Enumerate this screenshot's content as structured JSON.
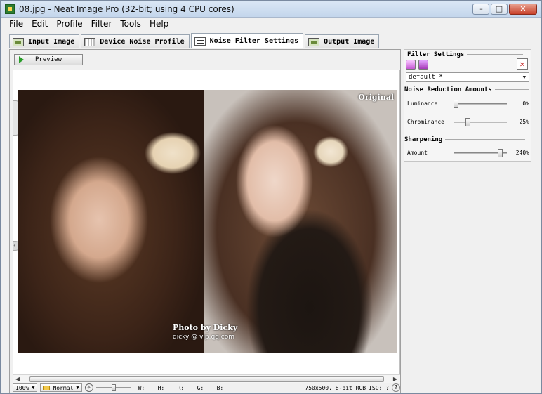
{
  "window": {
    "title": "08.jpg - Neat Image Pro (32-bit; using 4 CPU cores)",
    "minimize": "–",
    "maximize": "□",
    "close": "✕"
  },
  "menu": [
    "File",
    "Edit",
    "Profile",
    "Filter",
    "Tools",
    "Help"
  ],
  "tabs": [
    {
      "label": "Input Image",
      "icon": "input-image-icon"
    },
    {
      "label": "Device Noise Profile",
      "icon": "noise-profile-icon"
    },
    {
      "label": "Noise Filter Settings",
      "icon": "filter-settings-icon",
      "active": true
    },
    {
      "label": "Output Image",
      "icon": "output-image-icon"
    }
  ],
  "preview": {
    "button_label": "Preview",
    "overlay_label": "Original",
    "credit_line1": "Photo by Dicky",
    "credit_line2": "dicky @ vip.qq.com"
  },
  "statusbar": {
    "zoom": "100%",
    "mode": "Normal",
    "w_label": "W:",
    "h_label": "H:",
    "r_label": "R:",
    "g_label": "G:",
    "b_label": "B:",
    "image_info": "750x500, 8-bit RGB",
    "iso": "ISO: ?",
    "help": "?",
    "brightness_fraction": 0.5
  },
  "filter_panel": {
    "title": "Filter Settings",
    "preset": "default *",
    "noise_heading": "Noise Reduction Amounts",
    "sharpen_heading": "Sharpening",
    "params": [
      {
        "label": "Luminance",
        "value": "0%",
        "fraction": 0.0
      },
      {
        "label": "Chrominance",
        "value": "25%",
        "fraction": 0.25
      },
      {
        "label": "Amount",
        "value": "240%",
        "fraction": 0.92
      }
    ]
  },
  "colors": {
    "accent_play": "#2a9d2a",
    "close_red": "#c62828",
    "title_gradient_top": "#dbe7f5"
  }
}
